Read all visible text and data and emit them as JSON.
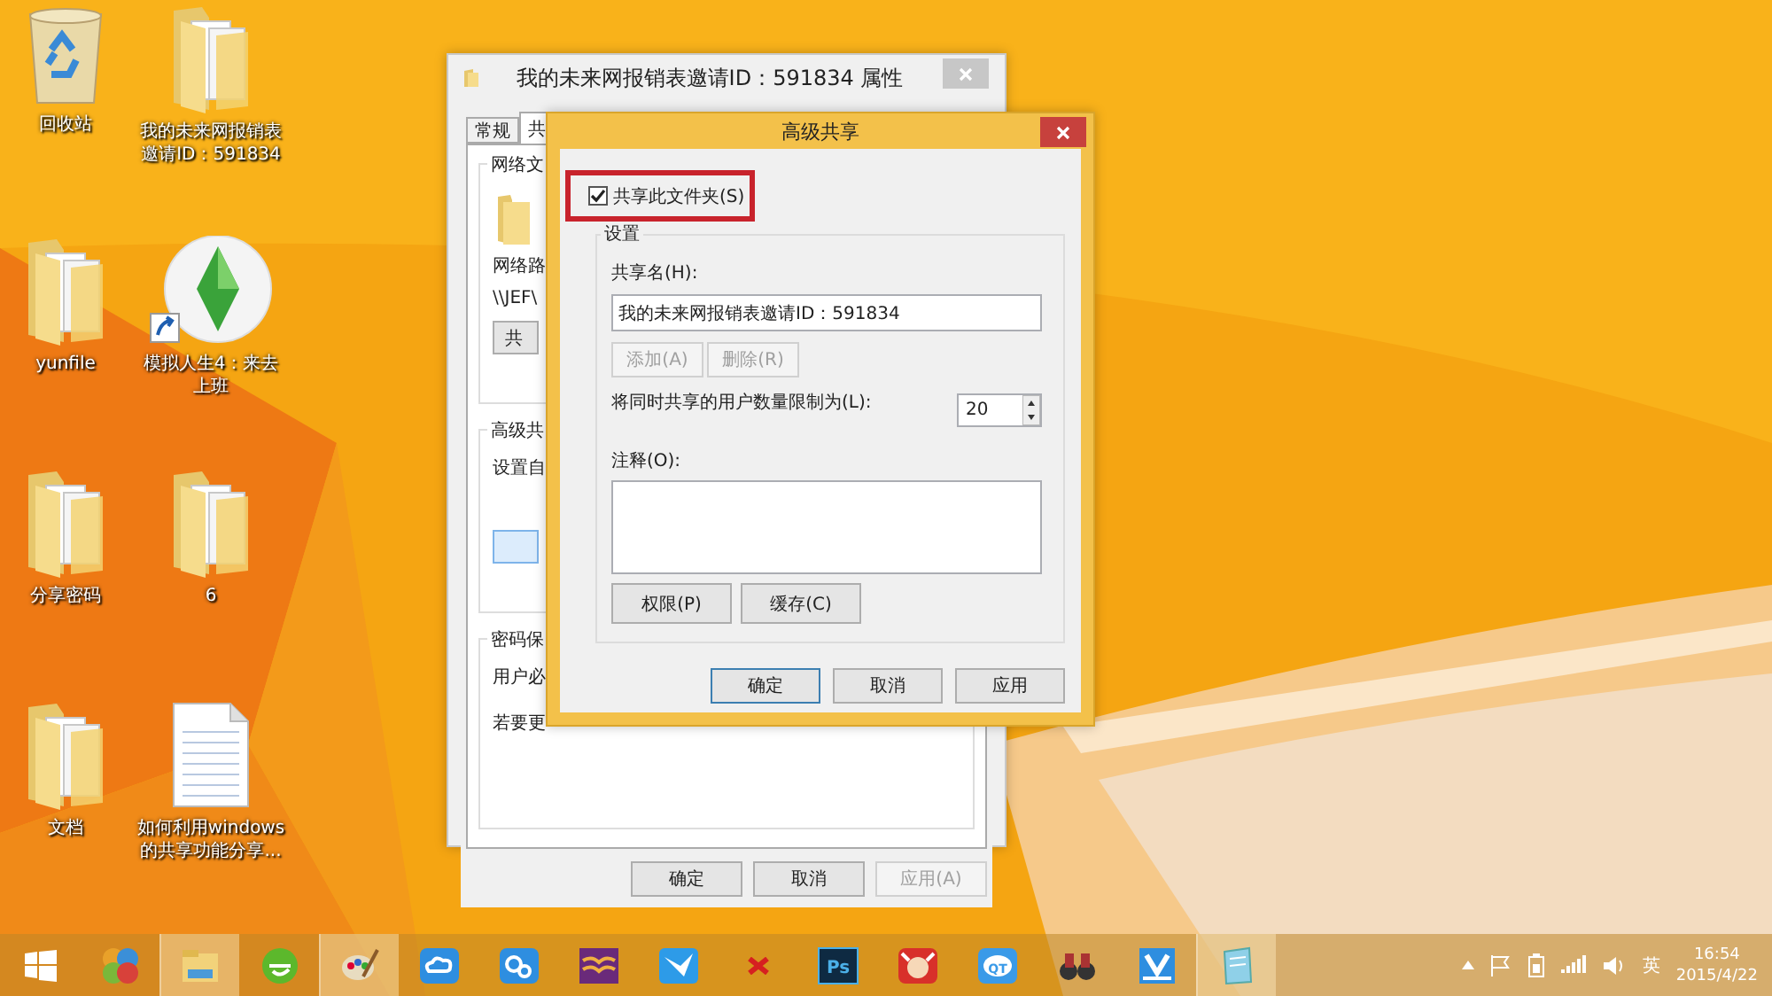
{
  "desktop_icons": [
    {
      "kind": "recycle_bin",
      "label": "回收站"
    },
    {
      "kind": "folder",
      "label": "我的未来网报销表邀请ID：591834"
    },
    {
      "kind": "folder",
      "label": "yunfile"
    },
    {
      "kind": "game_shortcut",
      "label": "模拟人生4：来去上班"
    },
    {
      "kind": "folder",
      "label": "分享密码"
    },
    {
      "kind": "folder",
      "label": "6"
    },
    {
      "kind": "folder",
      "label": "文档"
    },
    {
      "kind": "document",
      "label": "如何利用windows的共享功能分享..."
    }
  ],
  "properties_window": {
    "title": "我的未来网报销表邀请ID：591834 属性",
    "tabs": [
      {
        "label": "常规",
        "selected": false
      },
      {
        "label": "共",
        "selected": true
      }
    ],
    "sections": [
      {
        "title": "网络文",
        "folder_icon": true,
        "lines": [
          "网络路",
          "\\\\JEF\\"
        ],
        "button": {
          "label": "共",
          "highlighted": false
        }
      },
      {
        "title": "高级共",
        "folder_icon": false,
        "lines": [
          "设置自"
        ],
        "button": {
          "highlighted": true
        }
      },
      {
        "title": "密码保",
        "folder_icon": false,
        "lines": [
          "用户必",
          "若要更"
        ]
      }
    ],
    "buttons": [
      {
        "label": "确定",
        "disabled": false
      },
      {
        "label": "取消",
        "disabled": false
      },
      {
        "label": "应用(A)",
        "disabled": true
      }
    ]
  },
  "advanced_sharing": {
    "title": "高级共享",
    "share_checkbox": {
      "label": "共享此文件夹(S)",
      "checked": true,
      "highlighted": true
    },
    "settings_group": {
      "title": "设置",
      "share_name_label": "共享名(H):",
      "share_name": "我的未来网报销表邀请ID：591834",
      "name_buttons": [
        {
          "label": "添加(A)",
          "disabled": true
        },
        {
          "label": "删除(R)",
          "disabled": true
        }
      ],
      "limit_label": "将同时共享的用户数量限制为(L):",
      "limit_value": "20",
      "comment_label": "注释(O):",
      "action_buttons": [
        {
          "label": "权限(P)",
          "disabled": false
        },
        {
          "label": "缓存(C)",
          "disabled": false
        }
      ]
    },
    "buttons": [
      {
        "label": "确定",
        "default": true
      },
      {
        "label": "取消",
        "default": false
      },
      {
        "label": "应用",
        "default": false
      }
    ]
  },
  "taskbar": {
    "apps": [
      {
        "kind": "colorful_circles",
        "active": false
      },
      {
        "kind": "file_explorer",
        "active": true
      },
      {
        "kind": "green_globe",
        "active": false
      },
      {
        "kind": "paint",
        "active": true
      },
      {
        "kind": "cloud",
        "active": false
      },
      {
        "kind": "link",
        "active": false
      },
      {
        "kind": "book",
        "active": false
      },
      {
        "kind": "bird",
        "active": false
      },
      {
        "kind": "x_mark",
        "active": false
      },
      {
        "kind": "ps",
        "label": "Ps",
        "active": false
      },
      {
        "kind": "ox",
        "active": false
      },
      {
        "kind": "qt",
        "label": "QT",
        "active": false
      },
      {
        "kind": "binoculars",
        "active": false
      },
      {
        "kind": "v_logo",
        "active": false
      },
      {
        "kind": "notepad",
        "active": true
      }
    ],
    "tray": {
      "language": "英",
      "time": "16:54",
      "date": "2015/4/22"
    }
  }
}
